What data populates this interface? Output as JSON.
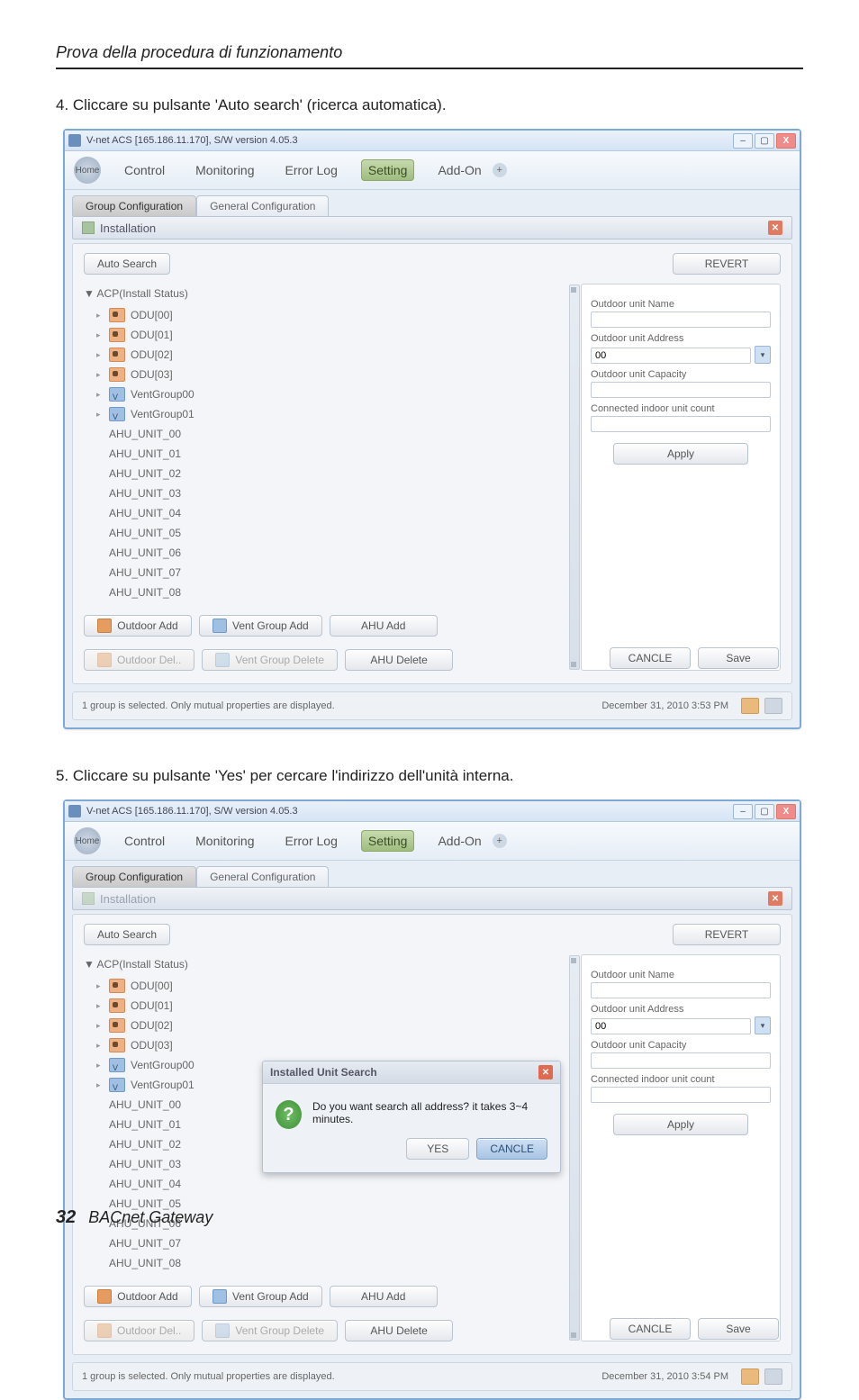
{
  "page": {
    "header": "Prova della procedura di funzionamento",
    "step4": "4. Cliccare su pulsante 'Auto search' (ricerca automatica).",
    "step5": "5. Cliccare su pulsante 'Yes' per cercare l'indirizzo dell'unità interna.",
    "footer_page": "32",
    "footer_product": "BACnet Gateway"
  },
  "app": {
    "title": "V-net ACS [165.186.11.170],   S/W version 4.05.3",
    "home": "Home",
    "menu": {
      "control": "Control",
      "monitoring": "Monitoring",
      "errorlog": "Error Log",
      "setting": "Setting",
      "addon": "Add-On"
    },
    "tabs": {
      "group": "Group Configuration",
      "general": "General Configuration"
    },
    "install_label": "Installation",
    "auto_search": "Auto Search",
    "revert": "REVERT",
    "acp_header": "▼ ACP(Install Status)",
    "tree": {
      "odu": [
        "ODU[00]",
        "ODU[01]",
        "ODU[02]",
        "ODU[03]"
      ],
      "vg": [
        "VentGroup00",
        "VentGroup01"
      ],
      "ahu": [
        "AHU_UNIT_00",
        "AHU_UNIT_01",
        "AHU_UNIT_02",
        "AHU_UNIT_03",
        "AHU_UNIT_04",
        "AHU_UNIT_05",
        "AHU_UNIT_06",
        "AHU_UNIT_07",
        "AHU_UNIT_08"
      ]
    },
    "side": {
      "name_label": "Outdoor unit Name",
      "addr_label": "Outdoor unit Address",
      "addr_value": "00",
      "cap_label": "Outdoor unit Capacity",
      "count_label": "Connected indoor unit count",
      "apply": "Apply"
    },
    "btns": {
      "outdoor_add": "Outdoor Add",
      "vent_add": "Vent Group Add",
      "ahu_add": "AHU Add",
      "outdoor_del": "Outdoor Del..",
      "vent_del": "Vent Group Delete",
      "ahu_del": "AHU Delete",
      "cancle": "CANCLE",
      "save": "Save"
    },
    "status": {
      "msg": "1 group is selected. Only mutual properties are displayed.",
      "time1": "December 31, 2010  3:53 PM",
      "time2": "December 31, 2010  3:54 PM"
    }
  },
  "modal": {
    "title": "Installed Unit Search",
    "msg": "Do you want search all address? it takes 3~4 minutes.",
    "yes": "YES",
    "cancle": "CANCLE"
  }
}
